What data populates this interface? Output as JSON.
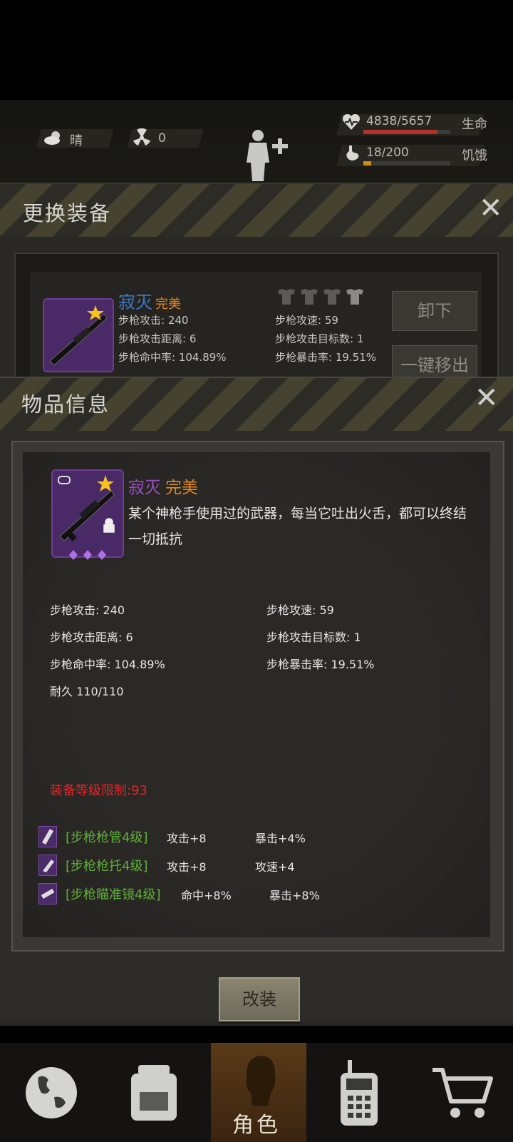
{
  "status": {
    "weather": "晴",
    "radiation": "0",
    "health_value": "4838/5657",
    "health_label": "生命",
    "health_ratio": 0.855,
    "hunger_value": "18/200",
    "hunger_label": "饥饿",
    "hunger_ratio": 0.09
  },
  "change_panel": {
    "title": "更换装备",
    "item_name": "寂灭",
    "item_quality": "完美",
    "stats_left": [
      "步枪攻击: 240",
      "步枪攻击距离: 6",
      "步枪命中率: 104.89%"
    ],
    "stats_right": [
      "步枪攻速: 59",
      "步枪攻击目标数: 1",
      "步枪暴击率: 19.51%"
    ],
    "unequip_label": "卸下",
    "remove_all_label": "一键移出"
  },
  "info_panel": {
    "title": "物品信息",
    "item_name": "寂灭",
    "item_quality": "完美",
    "description": "某个神枪手使用过的武器，每当它吐出火舌，都可以终结一切抵抗",
    "stats_left": [
      "步枪攻击: 240",
      "步枪攻击距离: 6",
      "步枪命中率: 104.89%",
      "耐久 110/110"
    ],
    "stats_right": [
      "步枪攻速: 59",
      "步枪攻击目标数: 1",
      "步枪暴击率: 19.51%"
    ],
    "level_limit": "装备等级限制:93",
    "mods": [
      {
        "name": "[步枪枪管4级]",
        "stat1": "攻击+8",
        "stat2": "暴击+4%"
      },
      {
        "name": "[步枪枪托4级]",
        "stat1": "攻击+8",
        "stat2": "攻速+4"
      },
      {
        "name": "[步枪瞄准镜4级]",
        "stat1": "命中+8%",
        "stat2": "暴击+8%"
      }
    ],
    "modify_label": "改装"
  },
  "nav": {
    "character_label": "角色"
  },
  "colors": {
    "name_purple": "#9a4fc0",
    "quality_orange": "#e8861e",
    "level_red": "#e0262a",
    "mod_green": "#5fae3a",
    "health_bar": "#b3322c",
    "hunger_bar": "#d08a1c"
  }
}
